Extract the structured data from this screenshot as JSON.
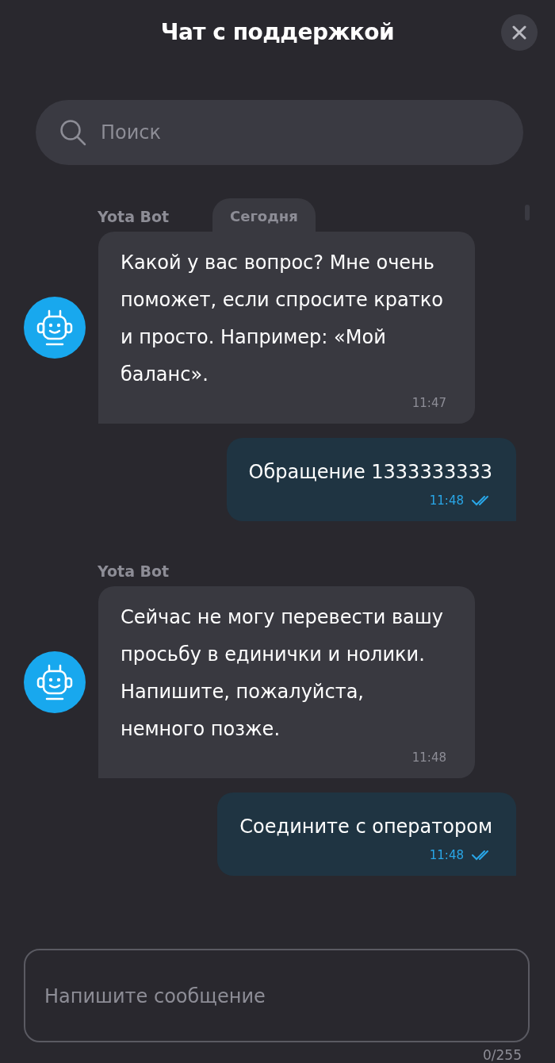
{
  "header": {
    "title": "Чат с поддержкой"
  },
  "search": {
    "placeholder": "Поиск"
  },
  "date_divider": "Сегодня",
  "messages": [
    {
      "kind": "incoming",
      "sender": "Yota Bot",
      "text": "Какой у вас вопрос? Мне очень поможет, если спросите кратко и просто. Например: «Мой баланс».",
      "time": "11:47"
    },
    {
      "kind": "outgoing",
      "text": "Обращение 1333333333",
      "time": "11:48",
      "read": true
    },
    {
      "kind": "incoming",
      "sender": "Yota Bot",
      "text": "Сейчас не могу перевести вашу просьбу в единички и нолики. Напишите, пожалуйста, немного позже.",
      "time": "11:48"
    },
    {
      "kind": "outgoing",
      "text": "Соедините с оператором",
      "time": "11:48",
      "read": true
    }
  ],
  "composer": {
    "placeholder": "Напишите сообщение",
    "counter": "0/255"
  }
}
